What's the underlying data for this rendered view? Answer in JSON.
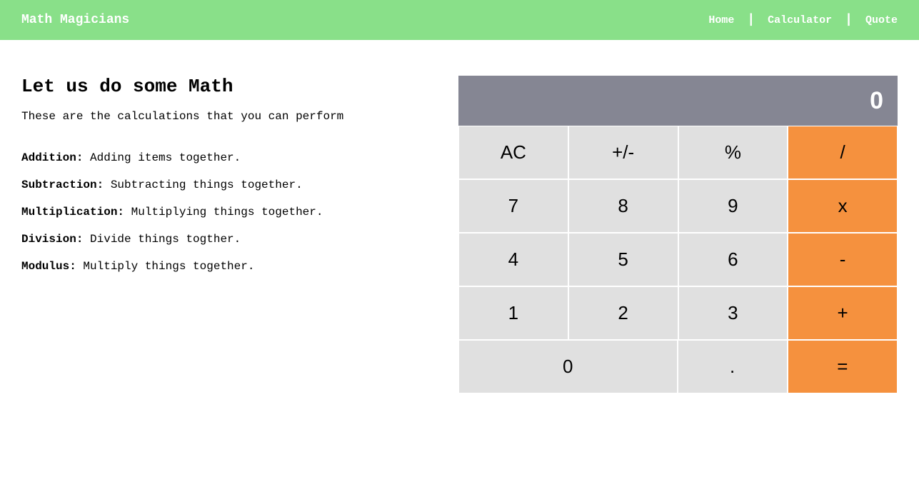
{
  "header": {
    "brand": "Math Magicians",
    "links": {
      "home": "Home",
      "calculator": "Calculator",
      "quote": "Quote"
    }
  },
  "content": {
    "title": "Let us do some Math",
    "subtitle": "These are the calculations that you can perform",
    "operations": [
      {
        "name": "Addition:",
        "desc": " Adding items together."
      },
      {
        "name": "Subtraction:",
        "desc": " Subtracting things together."
      },
      {
        "name": "Multiplication:",
        "desc": " Multiplying things together."
      },
      {
        "name": "Division:",
        "desc": " Divide things togther."
      },
      {
        "name": "Modulus:",
        "desc": " Multiply things together."
      }
    ]
  },
  "calculator": {
    "display": "0",
    "buttons": {
      "ac": "AC",
      "plusminus": "+/-",
      "percent": "%",
      "divide": "/",
      "seven": "7",
      "eight": "8",
      "nine": "9",
      "multiply": "x",
      "four": "4",
      "five": "5",
      "six": "6",
      "minus": "-",
      "one": "1",
      "two": "2",
      "three": "3",
      "plus": "+",
      "zero": "0",
      "dot": ".",
      "equals": "="
    }
  }
}
